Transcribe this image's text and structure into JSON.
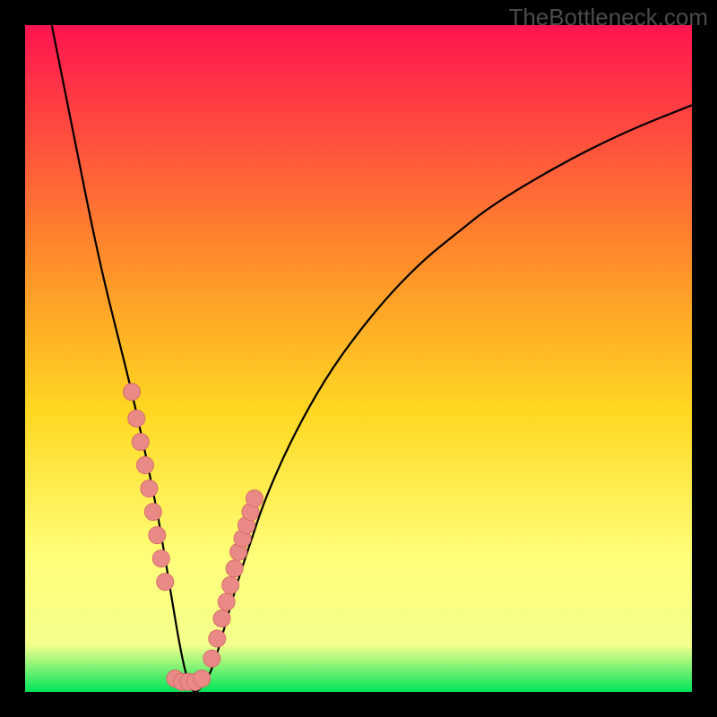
{
  "watermark": "TheBottleneck.com",
  "colors": {
    "frame": "#000000",
    "grad_top": "#ff1450",
    "grad_mid_upper": "#ff8d2a",
    "grad_mid": "#ffd822",
    "grad_lower": "#ffff7a",
    "grad_band": "#f4ff8c",
    "grad_bottom": "#00e55a",
    "curve": "#000000",
    "marker_fill": "#e98a87",
    "marker_stroke": "#d66e6b"
  },
  "chart_data": {
    "type": "line",
    "title": "",
    "xlabel": "",
    "ylabel": "",
    "xlim": [
      0,
      100
    ],
    "ylim": [
      0,
      100
    ],
    "grid": false,
    "legend": false,
    "series": [
      {
        "name": "bottleneck-curve",
        "x": [
          4,
          6,
          8,
          10,
          12,
          14,
          16,
          18,
          19,
          20,
          21,
          22,
          23,
          24,
          25,
          26,
          28,
          30,
          32,
          34,
          36,
          40,
          45,
          50,
          55,
          60,
          65,
          70,
          80,
          90,
          100
        ],
        "y": [
          100,
          90,
          80,
          70,
          61,
          53,
          45,
          36,
          31,
          26,
          20,
          14,
          8,
          3,
          0,
          0,
          3,
          10,
          17,
          23,
          29,
          38,
          47,
          54,
          60,
          65,
          69,
          73,
          79,
          84,
          88
        ]
      }
    ],
    "markers": {
      "name": "highlighted-points",
      "x": [
        16.0,
        16.7,
        17.3,
        18.0,
        18.6,
        19.2,
        19.8,
        20.4,
        21.0,
        22.5,
        23.5,
        24.5,
        25.5,
        26.5,
        28.0,
        28.8,
        29.5,
        30.2,
        30.8,
        31.4,
        32.0,
        32.6,
        33.2,
        33.8,
        34.4
      ],
      "y": [
        45.0,
        41.0,
        37.5,
        34.0,
        30.5,
        27.0,
        23.5,
        20.0,
        16.5,
        2.0,
        1.5,
        1.5,
        1.5,
        2.0,
        5.0,
        8.0,
        11.0,
        13.5,
        16.0,
        18.5,
        21.0,
        23.0,
        25.0,
        27.0,
        29.0
      ]
    }
  }
}
